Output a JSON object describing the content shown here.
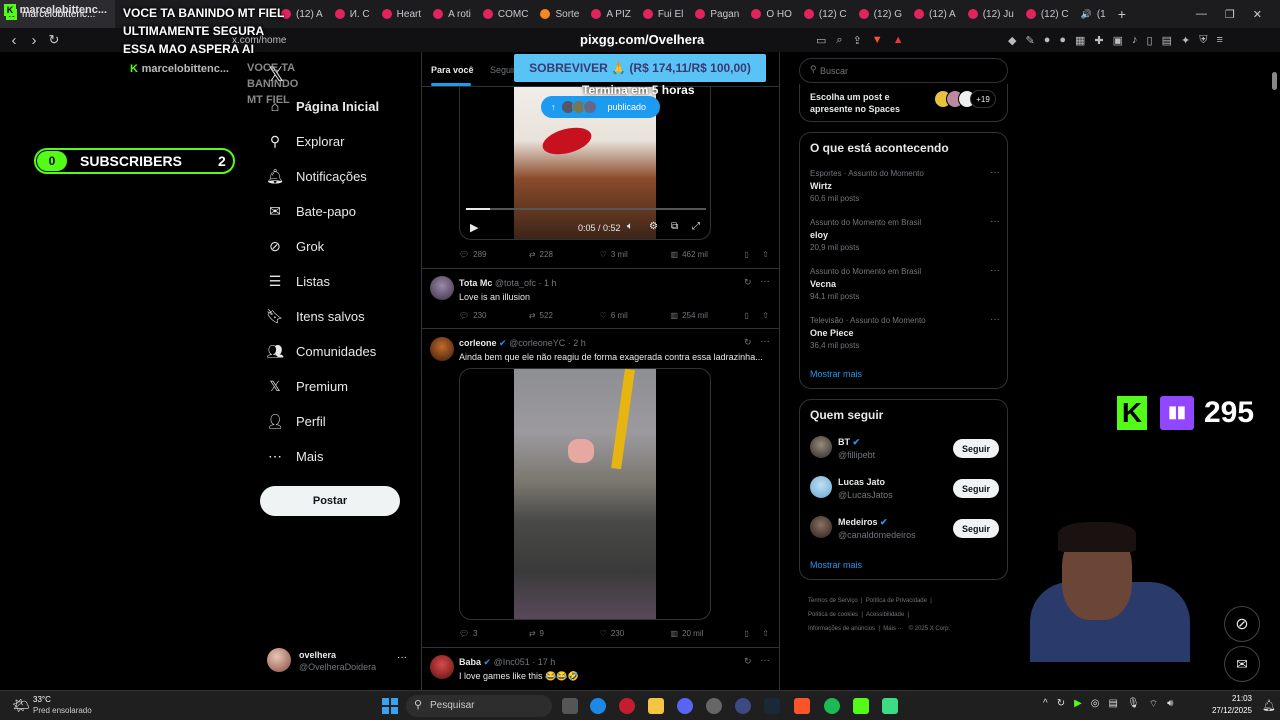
{
  "browser": {
    "tabs": [
      {
        "label": "marcelobittenc...",
        "active": true
      },
      {
        "label": "(12) A"
      },
      {
        "label": "И. С"
      },
      {
        "label": "Heart"
      },
      {
        "label": "A roti"
      },
      {
        "label": "COMC"
      },
      {
        "label": "Sorte"
      },
      {
        "label": "A PIZ"
      },
      {
        "label": "Fui El"
      },
      {
        "label": "Pagan"
      },
      {
        "label": "O HO"
      },
      {
        "label": "(12) C"
      },
      {
        "label": "(12) G"
      },
      {
        "label": "(12) A"
      },
      {
        "label": "(12) Ju"
      },
      {
        "label": "(12) C"
      },
      {
        "label": "(1"
      }
    ],
    "new_tab": "+",
    "url": "x.com/home",
    "overlay_url": "pixgg.com/Ovelhera"
  },
  "stream_overlay": {
    "chat_user": "marcelobittenc...",
    "chat_message": "VOCE TA BANINDO MT FIEL ULTIMAMENTE SEGURA ESSA MAO ASPERA AI",
    "chat_user_2": "marcelobittenc...",
    "chat_message_2": "VOCE TA BANINDO MT FIEL ULTIMAMENTE SEGURA ESSA MAO ASPERA AI",
    "subs_left": "0",
    "subs_label": "SUBSCRIBERS",
    "subs_right": "2",
    "goal_text": "SOBREVIVER 🙏 (R$ 174,11/R$ 100,00)",
    "goal_timer": "Termina em 5 horas",
    "kick_icon": "kick-logo",
    "twitch_count": "295"
  },
  "sidebar": {
    "items": [
      {
        "label": "Página Inicial",
        "icon": "home-icon"
      },
      {
        "label": "Explorar",
        "icon": "search-icon"
      },
      {
        "label": "Notificações",
        "icon": "bell-icon"
      },
      {
        "label": "Bate-papo",
        "icon": "mail-icon"
      },
      {
        "label": "Grok",
        "icon": "grok-icon"
      },
      {
        "label": "Listas",
        "icon": "list-icon"
      },
      {
        "label": "Itens salvos",
        "icon": "bookmark-icon"
      },
      {
        "label": "Comunidades",
        "icon": "people-icon"
      },
      {
        "label": "Premium",
        "icon": "x-icon"
      },
      {
        "label": "Perfil",
        "icon": "person-icon"
      },
      {
        "label": "Mais",
        "icon": "more-icon"
      }
    ],
    "post_button": "Postar",
    "account_name": "ovelhera",
    "account_handle": "@OvelheraDoidera",
    "more": "···"
  },
  "feed": {
    "tabs": [
      "Para você",
      "Seguindo"
    ],
    "published_pill": "publicado",
    "video": {
      "time": "0:05 / 0:52",
      "progress": 0.1
    },
    "tweet1_stats": {
      "replies": "289",
      "retweets": "228",
      "likes": "3 mil",
      "views": "462 mil"
    },
    "tweet2": {
      "name": "Tota Mc",
      "handle": "@tota_ofc",
      "time": "· 1 h",
      "text": "Love is an illusion",
      "replies": "230",
      "retweets": "522",
      "likes": "6 mil",
      "views": "254 mil"
    },
    "tweet3": {
      "name": "corleone",
      "handle": "@corleoneYC",
      "time": "· 2 h",
      "text": "Ainda bem que ele não reagiu de forma exagerada contra essa ladrazinha...",
      "replies": "3",
      "retweets": "9",
      "likes": "230",
      "views": "20 mil"
    },
    "tweet4": {
      "name": "Baba",
      "handle": "@Inc051",
      "time": "· 17 h",
      "text": "I love games like this 😂😂🤣"
    }
  },
  "right": {
    "search_placeholder": "Buscar",
    "spaces_text": "Escolha um post e apresente no Spaces",
    "spaces_count": "+19",
    "trends_title": "O que está acontecendo",
    "trends": [
      {
        "context": "Esportes · Assunto do Momento",
        "name": "Wirtz",
        "count": "60,6 mil posts"
      },
      {
        "context": "Assunto do Momento em Brasil",
        "name": "eloy",
        "count": "20,9 mil posts"
      },
      {
        "context": "Assunto do Momento em Brasil",
        "name": "Vecna",
        "count": "94,1 mil posts"
      },
      {
        "context": "Televisão · Assunto do Momento",
        "name": "One Piece",
        "count": "36,4 mil posts"
      }
    ],
    "show_more": "Mostrar mais",
    "follow_title": "Quem seguir",
    "follow": [
      {
        "name": "BT",
        "handle": "@fillipebt",
        "button": "Seguir"
      },
      {
        "name": "Lucas Jato",
        "handle": "@LucasJatos",
        "button": "Seguir"
      },
      {
        "name": "Medeiros",
        "handle": "@canaldomedeiros",
        "button": "Seguir"
      }
    ],
    "show_more_2": "Mostrar mais",
    "footer_links": [
      "Termos de Serviço",
      "Política de Privacidade",
      "Política de cookies",
      "Acessibilidade",
      "Informações de anúncios",
      "Mais ···",
      "© 2025 X Corp."
    ]
  },
  "taskbar": {
    "weather_temp": "33°C",
    "weather_desc": "Pred ensolarado",
    "search": "Pesquisar",
    "time": "21:03",
    "date": "27/12/2025"
  },
  "colors": {
    "accent": "#1d9bf0",
    "goal_bg": "#59c3f5",
    "subs_green": "#53fc18"
  }
}
